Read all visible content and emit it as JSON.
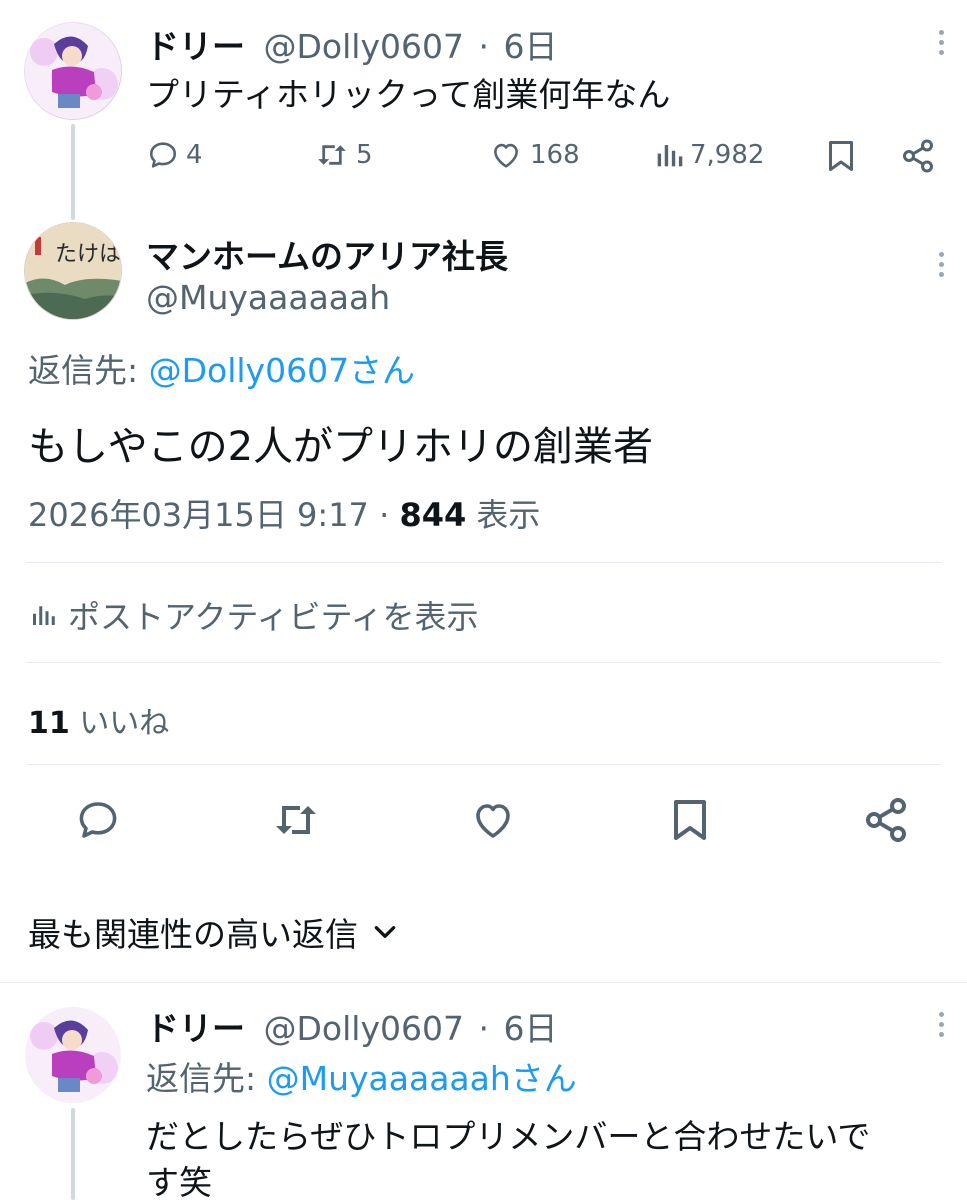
{
  "parent_tweet": {
    "name": "ドリー",
    "handle": "@Dolly0607",
    "separator": "·",
    "time": "6日",
    "text": "プリティホリックって創業何年なん",
    "replies": "4",
    "retweets": "5",
    "likes": "168",
    "views": "7,982"
  },
  "main_tweet": {
    "name": "マンホームのアリア社長",
    "handle": "@Muyaaaaaah",
    "reply_to_prefix": "返信先: ",
    "reply_to_handle": "@Dolly0607さん",
    "text": "もしやこの2人がプリホリの創業者",
    "datetime": "2026年03月15日 9:17 · ",
    "views_count": "844",
    "views_label": " 表示",
    "activity_label": "ポストアクティビティを表示",
    "likes_count": "11",
    "likes_label": " いいね",
    "avatar_text": "たけはらの塩"
  },
  "sort": {
    "label": "最も関連性の高い返信"
  },
  "reply_tweet": {
    "name": "ドリー",
    "handle": "@Dolly0607",
    "separator": "·",
    "time": "6日",
    "reply_to_prefix": "返信先: ",
    "reply_to_handle": "@Muyaaaaaahさん",
    "text_line1": "だとしたらぜひトロプリメンバーと合わせたいで",
    "text_line2": "す笑"
  },
  "colors": {
    "text": "#0f1419",
    "secondary": "#536471",
    "link": "#1d9bf0",
    "divider": "#e7ecf0"
  }
}
